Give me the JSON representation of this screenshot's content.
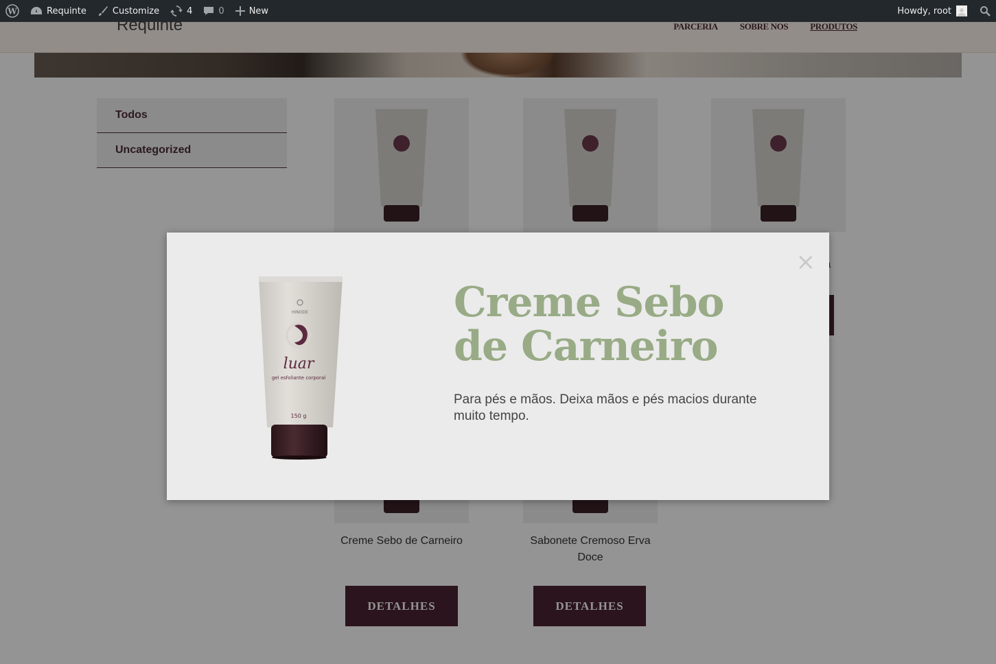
{
  "adminbar": {
    "site_name": "Requinte",
    "customize": "Customize",
    "updates_count": "4",
    "comments_count": "0",
    "new_label": "New",
    "howdy": "Howdy, root"
  },
  "header": {
    "logo": "Requinte",
    "nav": [
      "PARCERIA",
      "SOBRE NOS",
      "PRODUTOS"
    ],
    "active_nav": "PRODUTOS"
  },
  "categories": [
    "Todos",
    "Uncategorized"
  ],
  "products": [
    {
      "name": "",
      "button": ""
    },
    {
      "name": "",
      "button": ""
    },
    {
      "name": "ra",
      "button": ""
    },
    {
      "name": "Creme Sebo de Carneiro",
      "button": "DETALHES"
    },
    {
      "name": "Sabonete Cremoso Erva Doce",
      "button": "DETALHES"
    }
  ],
  "modal": {
    "close_symbol": "×",
    "title": "Creme Sebo de Carneiro",
    "description": "Para pés e mãos. Deixa mãos e pés macios durante muito tempo."
  },
  "product_image": {
    "brand": "HINODE",
    "line": "luar",
    "subtitle": "gel esfoliante corporal",
    "weight": "150 g"
  },
  "colors": {
    "accent": "#4a2433",
    "title_green": "#98ab86",
    "adminbar": "#23282d"
  }
}
